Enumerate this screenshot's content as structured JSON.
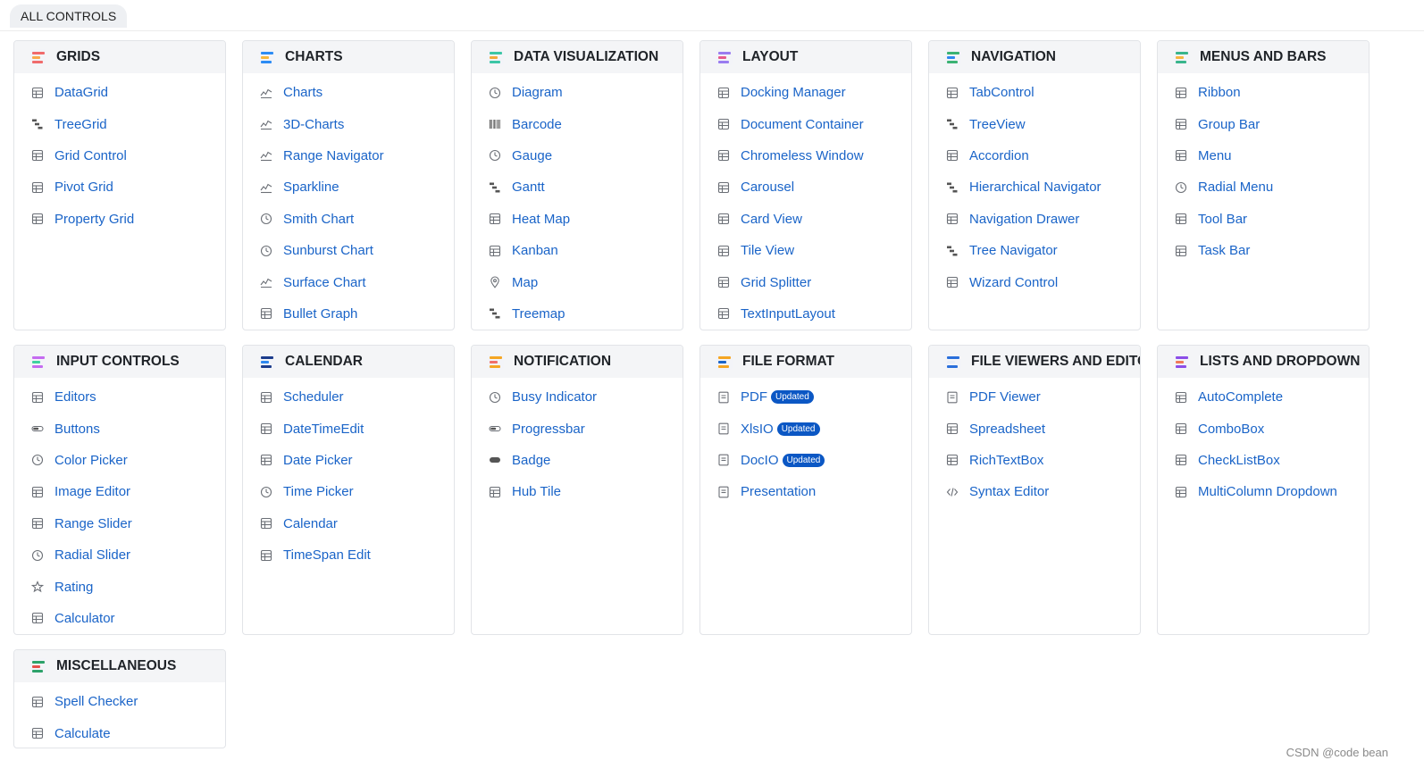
{
  "tab": {
    "label": "ALL CONTROLS"
  },
  "watermark": "CSDN @code bean",
  "categories": [
    {
      "title": "GRIDS",
      "icon": "grid-category-icon",
      "items": [
        {
          "label": "DataGrid",
          "icon": "datagrid-icon"
        },
        {
          "label": "TreeGrid",
          "icon": "treegrid-icon"
        },
        {
          "label": "Grid Control",
          "icon": "grid-control-icon"
        },
        {
          "label": "Pivot Grid",
          "icon": "pivot-grid-icon"
        },
        {
          "label": "Property Grid",
          "icon": "property-grid-icon"
        }
      ]
    },
    {
      "title": "CHARTS",
      "icon": "charts-category-icon",
      "items": [
        {
          "label": "Charts",
          "icon": "chart-icon"
        },
        {
          "label": "3D-Charts",
          "icon": "3d-chart-icon"
        },
        {
          "label": "Range Navigator",
          "icon": "range-navigator-icon"
        },
        {
          "label": "Sparkline",
          "icon": "sparkline-icon"
        },
        {
          "label": "Smith Chart",
          "icon": "smith-chart-icon"
        },
        {
          "label": "Sunburst Chart",
          "icon": "sunburst-chart-icon"
        },
        {
          "label": "Surface Chart",
          "icon": "surface-chart-icon"
        },
        {
          "label": "Bullet Graph",
          "icon": "bullet-graph-icon"
        }
      ]
    },
    {
      "title": "DATA VISUALIZATION",
      "icon": "data-visualization-category-icon",
      "items": [
        {
          "label": "Diagram",
          "icon": "diagram-icon"
        },
        {
          "label": "Barcode",
          "icon": "barcode-icon"
        },
        {
          "label": "Gauge",
          "icon": "gauge-icon"
        },
        {
          "label": "Gantt",
          "icon": "gantt-icon"
        },
        {
          "label": "Heat Map",
          "icon": "heat-map-icon"
        },
        {
          "label": "Kanban",
          "icon": "kanban-icon"
        },
        {
          "label": "Map",
          "icon": "map-pin-icon"
        },
        {
          "label": "Treemap",
          "icon": "treemap-icon"
        }
      ]
    },
    {
      "title": "LAYOUT",
      "icon": "layout-category-icon",
      "items": [
        {
          "label": "Docking Manager",
          "icon": "docking-icon"
        },
        {
          "label": "Document Container",
          "icon": "document-container-icon"
        },
        {
          "label": "Chromeless Window",
          "icon": "window-icon"
        },
        {
          "label": "Carousel",
          "icon": "carousel-icon"
        },
        {
          "label": "Card View",
          "icon": "card-view-icon"
        },
        {
          "label": "Tile View",
          "icon": "tile-view-icon"
        },
        {
          "label": "Grid Splitter",
          "icon": "grid-splitter-icon"
        },
        {
          "label": "TextInputLayout",
          "icon": "text-input-layout-icon"
        }
      ]
    },
    {
      "title": "NAVIGATION",
      "icon": "navigation-category-icon",
      "items": [
        {
          "label": "TabControl",
          "icon": "tab-control-icon"
        },
        {
          "label": "TreeView",
          "icon": "tree-view-icon"
        },
        {
          "label": "Accordion",
          "icon": "accordion-icon"
        },
        {
          "label": "Hierarchical Navigator",
          "icon": "hierarchical-navigator-icon"
        },
        {
          "label": "Navigation Drawer",
          "icon": "navigation-drawer-icon"
        },
        {
          "label": "Tree Navigator",
          "icon": "tree-navigator-icon"
        },
        {
          "label": "Wizard Control",
          "icon": "wizard-icon"
        }
      ]
    },
    {
      "title": "MENUS AND BARS",
      "icon": "menus-category-icon",
      "items": [
        {
          "label": "Ribbon",
          "icon": "ribbon-icon"
        },
        {
          "label": "Group Bar",
          "icon": "group-bar-icon"
        },
        {
          "label": "Menu",
          "icon": "menu-icon"
        },
        {
          "label": "Radial Menu",
          "icon": "radial-menu-icon"
        },
        {
          "label": "Tool Bar",
          "icon": "toolbar-icon"
        },
        {
          "label": "Task Bar",
          "icon": "taskbar-icon"
        }
      ]
    },
    {
      "title": "INPUT CONTROLS",
      "icon": "input-controls-category-icon",
      "items": [
        {
          "label": "Editors",
          "icon": "editors-icon"
        },
        {
          "label": "Buttons",
          "icon": "button-icon"
        },
        {
          "label": "Color Picker",
          "icon": "palette-icon"
        },
        {
          "label": "Image Editor",
          "icon": "image-editor-icon"
        },
        {
          "label": "Range Slider",
          "icon": "range-slider-icon"
        },
        {
          "label": "Radial Slider",
          "icon": "radial-slider-icon"
        },
        {
          "label": "Rating",
          "icon": "star-icon"
        },
        {
          "label": "Calculator",
          "icon": "calculator-icon"
        }
      ]
    },
    {
      "title": "CALENDAR",
      "icon": "calendar-category-icon",
      "items": [
        {
          "label": "Scheduler",
          "icon": "scheduler-icon"
        },
        {
          "label": "DateTimeEdit",
          "icon": "datetime-icon"
        },
        {
          "label": "Date Picker",
          "icon": "date-picker-icon"
        },
        {
          "label": "Time Picker",
          "icon": "clock-icon"
        },
        {
          "label": "Calendar",
          "icon": "calendar-icon"
        },
        {
          "label": "TimeSpan Edit",
          "icon": "timespan-icon"
        }
      ]
    },
    {
      "title": "NOTIFICATION",
      "icon": "notification-category-icon",
      "items": [
        {
          "label": "Busy Indicator",
          "icon": "busy-indicator-icon"
        },
        {
          "label": "Progressbar",
          "icon": "progressbar-icon"
        },
        {
          "label": "Badge",
          "icon": "badge-icon"
        },
        {
          "label": "Hub Tile",
          "icon": "hub-tile-icon"
        }
      ]
    },
    {
      "title": "FILE FORMAT",
      "icon": "file-format-category-icon",
      "items": [
        {
          "label": "PDF",
          "icon": "pdf-file-icon",
          "badge": "Updated"
        },
        {
          "label": "XlsIO",
          "icon": "excel-file-icon",
          "badge": "Updated"
        },
        {
          "label": "DocIO",
          "icon": "word-file-icon",
          "badge": "Updated"
        },
        {
          "label": "Presentation",
          "icon": "presentation-file-icon"
        }
      ]
    },
    {
      "title": "FILE VIEWERS AND EDITORS",
      "icon": "file-viewers-category-icon",
      "items": [
        {
          "label": "PDF Viewer",
          "icon": "pdf-viewer-icon"
        },
        {
          "label": "Spreadsheet",
          "icon": "spreadsheet-icon"
        },
        {
          "label": "RichTextBox",
          "icon": "richtextbox-icon"
        },
        {
          "label": "Syntax Editor",
          "icon": "code-icon"
        }
      ]
    },
    {
      "title": "LISTS AND DROPDOWN",
      "icon": "lists-category-icon",
      "items": [
        {
          "label": "AutoComplete",
          "icon": "autocomplete-icon"
        },
        {
          "label": "ComboBox",
          "icon": "combobox-icon"
        },
        {
          "label": "CheckListBox",
          "icon": "checklist-icon"
        },
        {
          "label": "MultiColumn Dropdown",
          "icon": "multicolumn-dropdown-icon"
        }
      ]
    },
    {
      "title": "MISCELLANEOUS",
      "icon": "miscellaneous-category-icon",
      "items": [
        {
          "label": "Spell Checker",
          "icon": "spell-checker-icon"
        },
        {
          "label": "Calculate",
          "icon": "calculate-icon"
        }
      ]
    }
  ],
  "colors": {
    "link": "#1a64c8",
    "header_bg": "#f4f5f7",
    "badge_bg": "#0b57c4"
  }
}
